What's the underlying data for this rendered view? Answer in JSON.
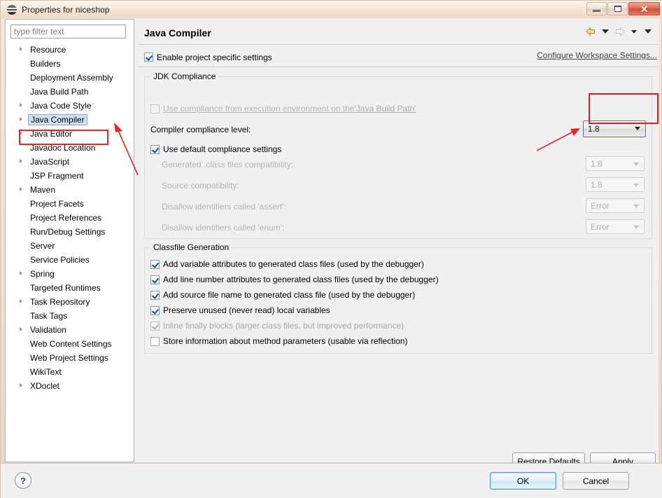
{
  "window": {
    "title": "Properties for niceshop",
    "icon": "eclipse-properties-icon",
    "controls": {
      "minimize": "–",
      "maximize": "□",
      "close": "✕"
    }
  },
  "sidebar": {
    "filter": {
      "placeholder": "type filter text",
      "value": ""
    },
    "items": [
      {
        "label": "Resource",
        "expandable": true,
        "selected": false
      },
      {
        "label": "Builders",
        "expandable": false,
        "selected": false
      },
      {
        "label": "Deployment Assembly",
        "expandable": false,
        "selected": false
      },
      {
        "label": "Java Build Path",
        "expandable": false,
        "selected": false
      },
      {
        "label": "Java Code Style",
        "expandable": true,
        "selected": false
      },
      {
        "label": "Java Compiler",
        "expandable": true,
        "selected": true
      },
      {
        "label": "Java Editor",
        "expandable": true,
        "selected": false
      },
      {
        "label": "Javadoc Location",
        "expandable": false,
        "selected": false
      },
      {
        "label": "JavaScript",
        "expandable": true,
        "selected": false
      },
      {
        "label": "JSP Fragment",
        "expandable": false,
        "selected": false
      },
      {
        "label": "Maven",
        "expandable": true,
        "selected": false
      },
      {
        "label": "Project Facets",
        "expandable": false,
        "selected": false
      },
      {
        "label": "Project References",
        "expandable": false,
        "selected": false
      },
      {
        "label": "Run/Debug Settings",
        "expandable": false,
        "selected": false
      },
      {
        "label": "Server",
        "expandable": false,
        "selected": false
      },
      {
        "label": "Service Policies",
        "expandable": false,
        "selected": false
      },
      {
        "label": "Spring",
        "expandable": true,
        "selected": false
      },
      {
        "label": "Targeted Runtimes",
        "expandable": false,
        "selected": false
      },
      {
        "label": "Task Repository",
        "expandable": true,
        "selected": false
      },
      {
        "label": "Task Tags",
        "expandable": false,
        "selected": false
      },
      {
        "label": "Validation",
        "expandable": true,
        "selected": false
      },
      {
        "label": "Web Content Settings",
        "expandable": false,
        "selected": false
      },
      {
        "label": "Web Project Settings",
        "expandable": false,
        "selected": false
      },
      {
        "label": "WikiText",
        "expandable": false,
        "selected": false
      },
      {
        "label": "XDoclet",
        "expandable": true,
        "selected": false
      }
    ]
  },
  "page": {
    "title": "Java Compiler",
    "nav": {
      "back_icon": "arrow-left-icon",
      "back_menu_icon": "chevron-down-icon",
      "forward_icon": "arrow-right-icon",
      "forward_menu_icon": "chevron-down-icon",
      "view_menu_icon": "chevron-down-icon"
    },
    "enable_project_specific": {
      "label": "Enable project specific settings",
      "checked": true
    },
    "configure_workspace_link": "Configure Workspace Settings...",
    "jdk_compliance": {
      "title": "JDK Compliance",
      "use_compliance_from_ee": {
        "label_prefix": "Use compliance from execution environment on the ",
        "label_link": "'Java Build Path'",
        "checked": false,
        "enabled": false
      },
      "compiler_compliance_level": {
        "label": "Compiler compliance level:",
        "value": "1.8",
        "enabled": true,
        "highlighted": true
      },
      "use_default_compliance": {
        "label": "Use default compliance settings",
        "checked": true,
        "enabled": true
      },
      "rows": [
        {
          "label": "Generated .class files compatibility:",
          "value": "1.8",
          "enabled": false
        },
        {
          "label": "Source compatibility:",
          "value": "1.8",
          "enabled": false
        },
        {
          "label": "Disallow identifiers called 'assert':",
          "value": "Error",
          "enabled": false
        },
        {
          "label": "Disallow identifiers called 'enum':",
          "value": "Error",
          "enabled": false
        }
      ]
    },
    "classfile_generation": {
      "title": "Classfile Generation",
      "options": [
        {
          "label": "Add variable attributes to generated class files (used by the debugger)",
          "checked": true,
          "enabled": true
        },
        {
          "label": "Add line number attributes to generated class files (used by the debugger)",
          "checked": true,
          "enabled": true
        },
        {
          "label": "Add source file name to generated class file (used by the debugger)",
          "checked": true,
          "enabled": true
        },
        {
          "label": "Preserve unused (never read) local variables",
          "checked": true,
          "enabled": true
        },
        {
          "label": "Inline finally blocks (larger class files, but improved performance)",
          "checked": true,
          "enabled": false
        },
        {
          "label": "Store information about method parameters (usable via reflection)",
          "checked": false,
          "enabled": true
        }
      ]
    },
    "restore_defaults_label": "Restore Defaults",
    "apply_label": "Apply"
  },
  "footer": {
    "help_icon": "help-question-icon",
    "help_glyph": "?",
    "ok_label": "OK",
    "cancel_label": "Cancel"
  },
  "annotations": {
    "highlight_color": "#e4262b",
    "arrow_to_tree": "red-arrow-pointing-to-java-compiler",
    "arrow_to_combo": "red-arrow-pointing-to-compliance-level-combo"
  }
}
